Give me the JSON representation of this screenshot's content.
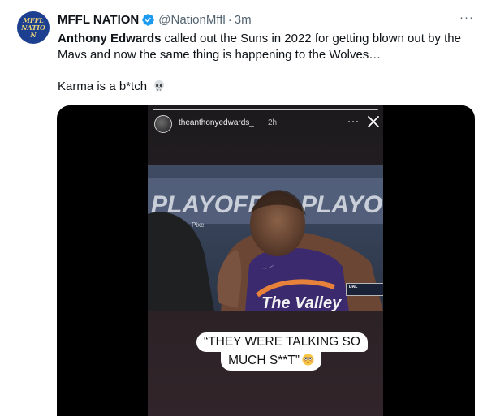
{
  "account": {
    "name": "MFFL NATION",
    "handle": "@NationMffl",
    "separator": "·",
    "time": "3m",
    "avatar_text": "MFFL NATION",
    "verified": true
  },
  "tweet": {
    "author_mention": "Anthony Edwards",
    "text_rest": " called out the Suns in 2022 for getting blown out by the Mavs and now the same thing is happening to the Wolves…",
    "karma_text": "Karma is a b*tch",
    "karma_emoji_icon": "skull-icon"
  },
  "story": {
    "username": "theanthonyedwards_",
    "time": "2h",
    "more_icon": "ellipsis-icon",
    "close_icon": "close-icon",
    "caption_line1": "“THEY WERE TALKING SO",
    "caption_line2": "MUCH S**T”",
    "caption_emoji_icon": "flushed-face-icon"
  },
  "video": {
    "banner_text_left": "PLAYOFFS",
    "banner_text_right": "PLAYOFFS",
    "sponsor_text": "Pixel",
    "jersey_text": "The Valley",
    "scorebug_team": "DAL"
  },
  "colors": {
    "verified_blue": "#1d9bf0",
    "text_primary": "#0f1419",
    "text_secondary": "#536471",
    "jersey_purple": "#3b2a6e",
    "avatar_blue": "#1d3f8f"
  }
}
